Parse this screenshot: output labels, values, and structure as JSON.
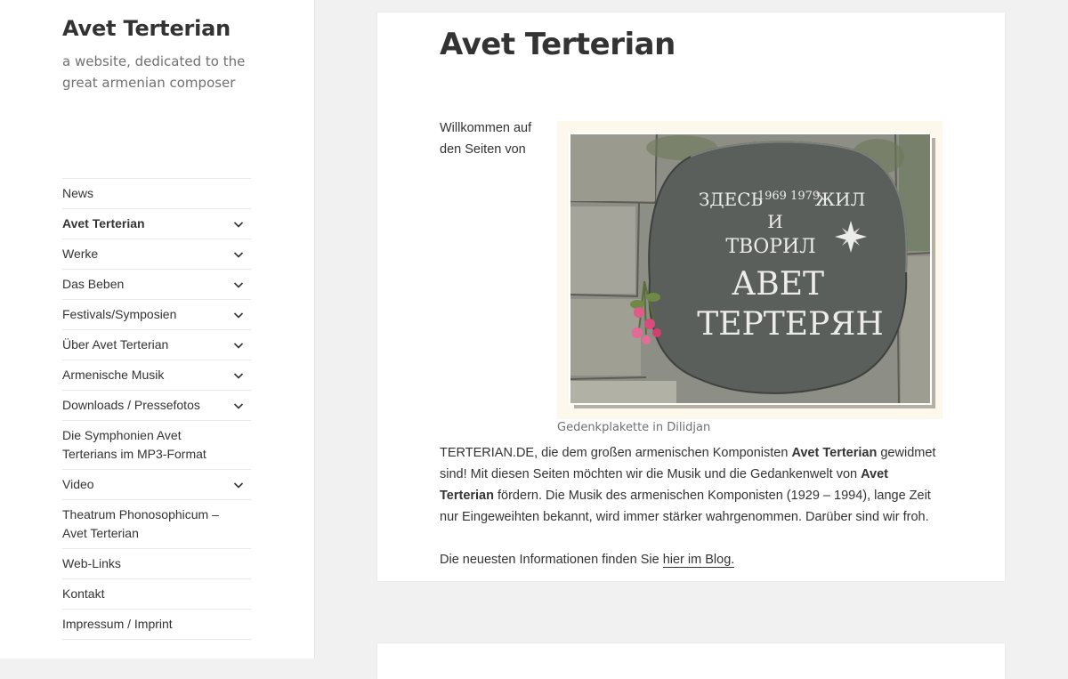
{
  "site": {
    "title": "Avet Terterian",
    "description": "a website, dedicated to the great armenian composer"
  },
  "nav": {
    "items": [
      {
        "label": "News",
        "has_submenu": false,
        "current": false
      },
      {
        "label": "Avet Terterian",
        "has_submenu": true,
        "current": true
      },
      {
        "label": "Werke",
        "has_submenu": true,
        "current": false
      },
      {
        "label": "Das Beben",
        "has_submenu": true,
        "current": false
      },
      {
        "label": "Festivals/Symposien",
        "has_submenu": true,
        "current": false
      },
      {
        "label": "Über Avet Terterian",
        "has_submenu": true,
        "current": false
      },
      {
        "label": "Armenische Musik",
        "has_submenu": true,
        "current": false
      },
      {
        "label": "Downloads / Pressefotos",
        "has_submenu": true,
        "current": false
      },
      {
        "label": "Die Symphonien Avet Terterians im MP3-Format",
        "has_submenu": false,
        "current": false
      },
      {
        "label": "Video",
        "has_submenu": true,
        "current": false
      },
      {
        "label": "Theatrum Phonosophicum – Avet Terterian",
        "has_submenu": false,
        "current": false
      },
      {
        "label": "Web-Links",
        "has_submenu": false,
        "current": false
      },
      {
        "label": "Kontakt",
        "has_submenu": false,
        "current": false
      },
      {
        "label": "Impressum / Imprint",
        "has_submenu": false,
        "current": false
      }
    ],
    "chevron_icon": "chevron-down-icon"
  },
  "article": {
    "title": "Avet Terterian",
    "intro_1": "Willkommen auf den Seiten von TERTERIAN.DE, die dem großen armenischen Komponisten ",
    "intro_bold_1": "Avet Terterian",
    "intro_2": " gewidmet sind! Mit diesen Seiten möchten wir die Musik und die Gedankenwelt von ",
    "intro_bold_2": "Avet Terterian",
    "intro_3": " fördern. Die Musik des armenischen Komponisten (1929 – 1994), lange Zeit nur Eingeweihten bekannt, wird immer stärker wahrgenommen. Darüber sind wir froh.",
    "latest_prefix": "Die neuesten Informationen finden Sie ",
    "latest_link": "hier im Blog.",
    "figure": {
      "caption": "Gedenkplakette in Dilidjan",
      "plaque_line1": "ЗДЕСЬ",
      "plaque_years": "1969 1979",
      "plaque_line1b": "ЖИЛ",
      "plaque_line2": "И",
      "plaque_line3": "ТВОРИЛ",
      "plaque_name1": "АВЕТ",
      "plaque_name2": "ТЕРТЕРЯН"
    }
  },
  "colors": {
    "background": "#f1f1f1",
    "sidebar": "#ffffff",
    "text": "#333333",
    "muted": "#707070"
  }
}
